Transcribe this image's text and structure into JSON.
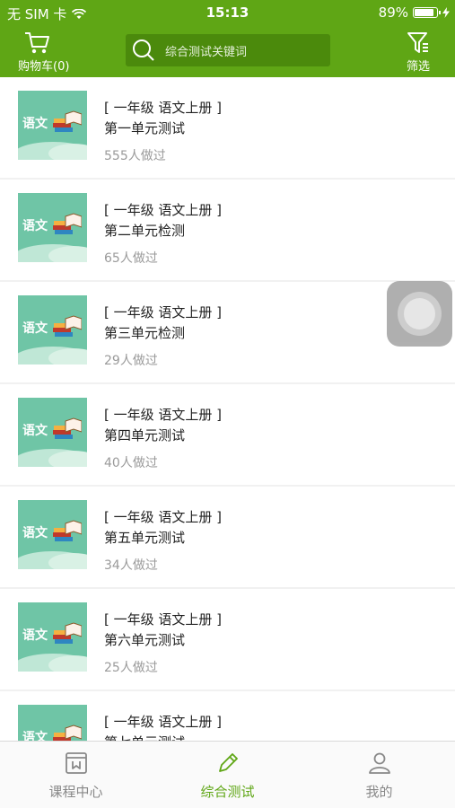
{
  "status_bar": {
    "carrier": "无 SIM 卡",
    "time": "15:13",
    "battery": "89%",
    "battery_level": 0.89
  },
  "nav": {
    "cart_label": "购物车(0)",
    "search_placeholder": "综合测试关键词",
    "filter_label": "筛选"
  },
  "thumbnail_text": "语文",
  "items": [
    {
      "subject": "[ 一年级 语文上册 ]",
      "title": "第一单元测试",
      "count": "555人做过"
    },
    {
      "subject": "[ 一年级 语文上册 ]",
      "title": "第二单元检测",
      "count": "65人做过"
    },
    {
      "subject": "[ 一年级 语文上册 ]",
      "title": "第三单元检测",
      "count": "29人做过"
    },
    {
      "subject": "[ 一年级 语文上册 ]",
      "title": "第四单元测试",
      "count": "40人做过"
    },
    {
      "subject": "[ 一年级 语文上册 ]",
      "title": "第五单元测试",
      "count": "34人做过"
    },
    {
      "subject": "[ 一年级 语文上册 ]",
      "title": "第六单元测试",
      "count": "25人做过"
    },
    {
      "subject": "[ 一年级 语文上册 ]",
      "title": "第七单元测试",
      "count": ""
    }
  ],
  "tabs": [
    {
      "label": "课程中心",
      "icon": "course-center-icon",
      "active": false
    },
    {
      "label": "综合测试",
      "icon": "pencil-icon",
      "active": true
    },
    {
      "label": "我的",
      "icon": "user-icon",
      "active": false
    }
  ],
  "colors": {
    "brand_green": "#5fa615",
    "search_bg": "#4b8a0c",
    "muted_text": "#9a9a9a"
  }
}
